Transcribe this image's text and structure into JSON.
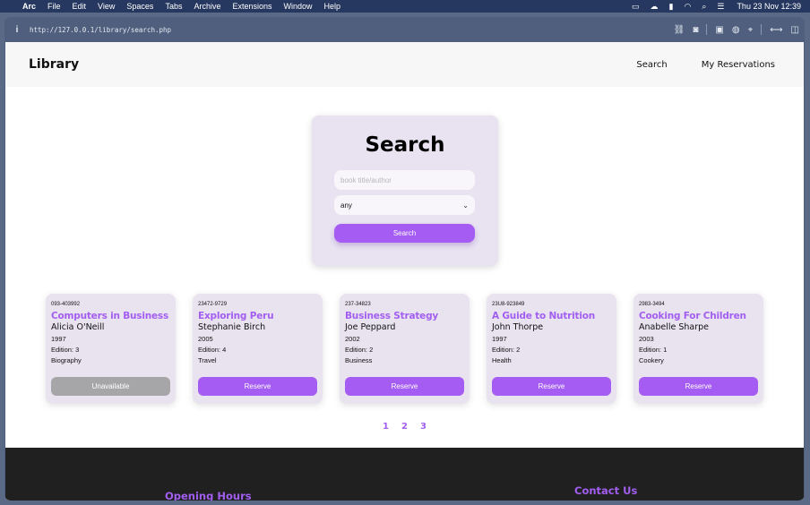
{
  "menubar": {
    "app": "Arc",
    "items": [
      "File",
      "Edit",
      "View",
      "Spaces",
      "Tabs",
      "Archive",
      "Extensions",
      "Window",
      "Help"
    ],
    "clock": "Thu 23 Nov  12:39"
  },
  "browser": {
    "url": "http://127.0.0.1/library/search.php"
  },
  "site": {
    "brand": "Library",
    "nav": [
      "Search",
      "My Reservations"
    ]
  },
  "search": {
    "title": "Search",
    "placeholder": "book title/author",
    "category_selected": "any",
    "button": "Search"
  },
  "books": [
    {
      "isbn": "093-403992",
      "title": "Computers in Business",
      "author": "Alicia O'Neill",
      "year": "1997",
      "edition": "Edition: 3",
      "genre": "Biography",
      "action": "Unavailable",
      "available": false
    },
    {
      "isbn": "23472-9729",
      "title": "Exploring Peru",
      "author": "Stephanie Birch",
      "year": "2005",
      "edition": "Edition: 4",
      "genre": "Travel",
      "action": "Reserve",
      "available": true
    },
    {
      "isbn": "237-34823",
      "title": "Business Strategy",
      "author": "Joe Peppard",
      "year": "2002",
      "edition": "Edition: 2",
      "genre": "Business",
      "action": "Reserve",
      "available": true
    },
    {
      "isbn": "23U8-923849",
      "title": "A Guide to Nutrition",
      "author": "John Thorpe",
      "year": "1997",
      "edition": "Edition: 2",
      "genre": "Health",
      "action": "Reserve",
      "available": true
    },
    {
      "isbn": "2983-3494",
      "title": "Cooking For Children",
      "author": "Anabelle Sharpe",
      "year": "2003",
      "edition": "Edition: 1",
      "genre": "Cookery",
      "action": "Reserve",
      "available": true
    }
  ],
  "pagination": [
    "1",
    "2",
    "3"
  ],
  "footer": {
    "opening_hours": "Opening Hours",
    "contact": "Contact Us"
  }
}
